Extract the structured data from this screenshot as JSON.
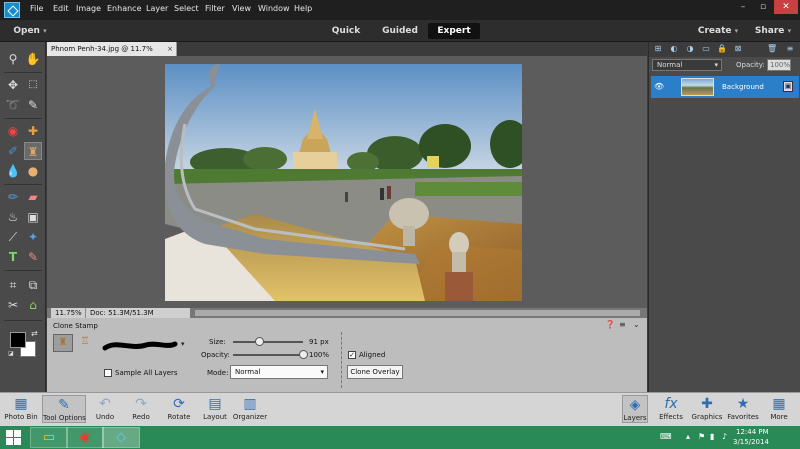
{
  "menubar": {
    "items": [
      "File",
      "Edit",
      "Image",
      "Enhance",
      "Layer",
      "Select",
      "Filter",
      "View",
      "Window",
      "Help"
    ]
  },
  "modebar": {
    "open": "Open",
    "quick": "Quick",
    "guided": "Guided",
    "expert": "Expert",
    "create": "Create",
    "share": "Share"
  },
  "document": {
    "tab_title": "Phnom Penh-34.jpg @ 11.7% (RGB/8)",
    "close": "×",
    "zoom": "11.75%",
    "doc_size": "Doc: 51.3M/51.3M"
  },
  "tool_options": {
    "tool_name": "Clone Stamp",
    "size_label": "Size:",
    "size_value": "91 px",
    "size_fraction": 0.37,
    "opacity_label": "Opacity:",
    "opacity_value": "100%",
    "opacity_fraction": 1.0,
    "sample_all_layers": "Sample All Layers",
    "mode_label": "Mode:",
    "mode_value": "Normal",
    "aligned_label": "Aligned",
    "aligned_checked": true,
    "clone_overlay": "Clone Overlay"
  },
  "layers_panel": {
    "blend_mode": "Normal",
    "opacity_label": "Opacity:",
    "opacity_value": "100%",
    "layer_name": "Background"
  },
  "bottombar": {
    "left": [
      {
        "label": "Photo Bin",
        "icon": "photo-bin-icon"
      },
      {
        "label": "Tool Options",
        "icon": "tool-options-icon"
      },
      {
        "label": "Undo",
        "icon": "undo-icon"
      },
      {
        "label": "Redo",
        "icon": "redo-icon"
      },
      {
        "label": "Rotate",
        "icon": "rotate-icon"
      },
      {
        "label": "Layout",
        "icon": "layout-icon"
      },
      {
        "label": "Organizer",
        "icon": "organizer-icon"
      }
    ],
    "right": [
      {
        "label": "Layers",
        "icon": "layers-icon"
      },
      {
        "label": "Effects",
        "icon": "effects-icon"
      },
      {
        "label": "Graphics",
        "icon": "graphics-icon"
      },
      {
        "label": "Favorites",
        "icon": "favorites-icon"
      },
      {
        "label": "More",
        "icon": "more-icon"
      }
    ]
  },
  "taskbar": {
    "time": "12:44 PM",
    "date": "3/15/2014"
  },
  "colors": {
    "accent": "#2b7fc9",
    "taskbar": "#2a8a57",
    "foreground_swatch": "#000000",
    "background_swatch": "#ffffff"
  }
}
